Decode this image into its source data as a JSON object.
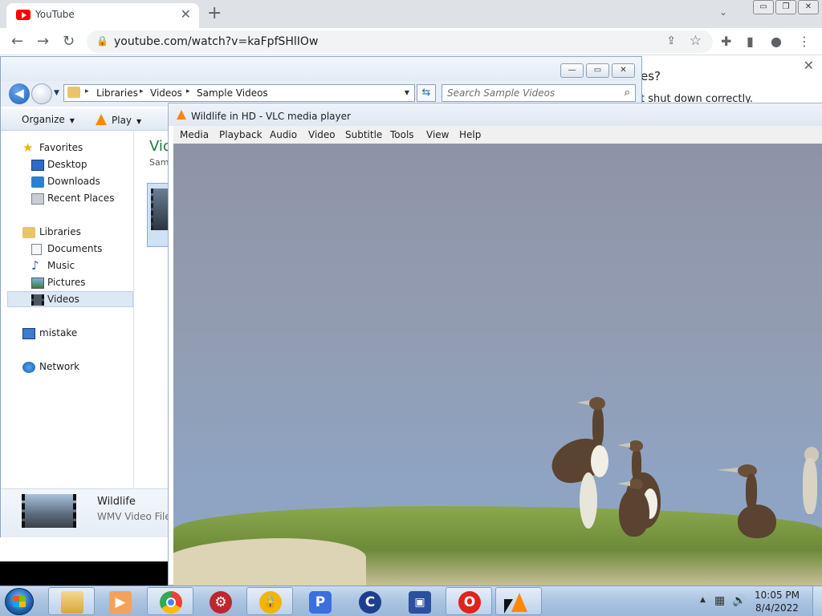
{
  "chrome": {
    "tab_title": "YouTube",
    "tab_close": "✕",
    "new_tab": "+",
    "tab_dropdown": "⌄",
    "url": "youtube.com/watch?v=kaFpfSHlIOw",
    "back": "←",
    "forward": "→",
    "reload": "↻",
    "lock_icon": "🔒",
    "share_icon": "⇪",
    "star_icon": "☆",
    "extensions_icon": "✚",
    "sidepanel_icon": "▮",
    "profile_icon": "●",
    "menu_icon": "⋮",
    "win_min": "▭",
    "win_max": "❐",
    "win_close": "✕",
    "dialog_line1": "es?",
    "dialog_line2": "t shut down correctly.",
    "dialog_close": "✕"
  },
  "explorer": {
    "win_min": "—",
    "win_max": "▭",
    "win_close": "✕",
    "breadcrumbs": [
      "Libraries",
      "Videos",
      "Sample Videos"
    ],
    "crumb_sep": "▸",
    "search_placeholder": "Search Sample Videos",
    "search_icon": "⌕",
    "refresh_icon": "⇆",
    "commands": {
      "organize": "Organize",
      "play": "Play"
    },
    "caret": "▼",
    "nav": {
      "favorites": "Favorites",
      "desktop": "Desktop",
      "downloads": "Downloads",
      "recent_places": "Recent Places",
      "libraries": "Libraries",
      "documents": "Documents",
      "music": "Music",
      "pictures": "Pictures",
      "videos": "Videos",
      "computer": "mistake",
      "network": "Network"
    },
    "content": {
      "title": "Vic",
      "subtitle": "Sam"
    },
    "details": {
      "name": "Wildlife",
      "type": "WMV Video File"
    }
  },
  "vlc": {
    "title": "Wildlife in HD - VLC media player",
    "menus": [
      "Media",
      "Playback",
      "Audio",
      "Video",
      "Subtitle",
      "Tools",
      "View",
      "Help"
    ]
  },
  "taskbar": {
    "apps": [
      {
        "name": "explorer",
        "color": "#e9c46a",
        "label": ""
      },
      {
        "name": "media-player",
        "color": "#f4a259",
        "label": "▶"
      },
      {
        "name": "chrome",
        "color": "#34a853",
        "label": ""
      },
      {
        "name": "app-red",
        "color": "#c0262d",
        "label": "⚙"
      },
      {
        "name": "app-lock",
        "color": "#f5b400",
        "label": "🔒"
      },
      {
        "name": "app-p",
        "color": "#3b6fe0",
        "label": "P"
      },
      {
        "name": "app-c",
        "color": "#1d3f8f",
        "label": "C"
      },
      {
        "name": "app-screen",
        "color": "#2c4f9e",
        "label": "▣"
      },
      {
        "name": "opera",
        "color": "#e2231a",
        "label": "O"
      },
      {
        "name": "vlc",
        "color": "#ff8800",
        "label": ""
      }
    ],
    "tray_arrow": "▲",
    "tray_network": "▦",
    "tray_volume": "🔊",
    "clock_time": "10:05 PM",
    "clock_date": "8/4/2022"
  }
}
